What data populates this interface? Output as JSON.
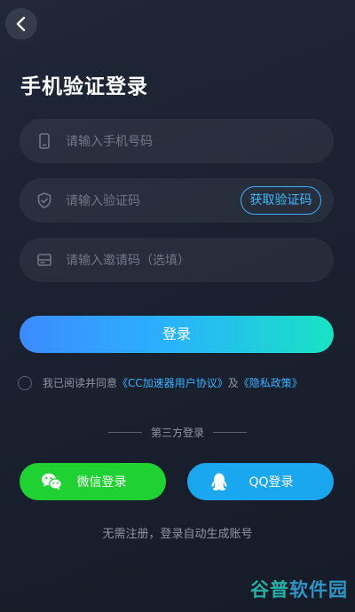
{
  "header": {
    "back_icon": "chevron-left-icon",
    "title": "手机验证登录"
  },
  "form": {
    "phone": {
      "icon": "phone-icon",
      "placeholder": "请输入手机号码",
      "value": ""
    },
    "code": {
      "icon": "shield-icon",
      "placeholder": "请输入验证码",
      "value": "",
      "get_code_label": "获取验证码"
    },
    "invite": {
      "icon": "card-icon",
      "placeholder": "请输入邀请码（选填）",
      "value": ""
    }
  },
  "login_button": "登录",
  "agreement": {
    "checked": false,
    "prefix": "我已阅读并同意",
    "user_agreement": "《CC加速器用户协议》",
    "and": "及",
    "privacy_policy": "《隐私政策》"
  },
  "third_party": {
    "divider_label": "第三方登录",
    "wechat_label": "微信登录",
    "qq_label": "QQ登录"
  },
  "hint": "无需注册，登录自动生成账号",
  "watermark": {
    "part1": "谷普",
    "part2": "软件园"
  },
  "colors": {
    "accent_blue": "#3ab2ff",
    "login_gradient_start": "#3d8bff",
    "login_gradient_end": "#18e3c3",
    "wechat_green": "#1fd232",
    "qq_blue": "#1aa7ef",
    "background": "#1c2332"
  }
}
